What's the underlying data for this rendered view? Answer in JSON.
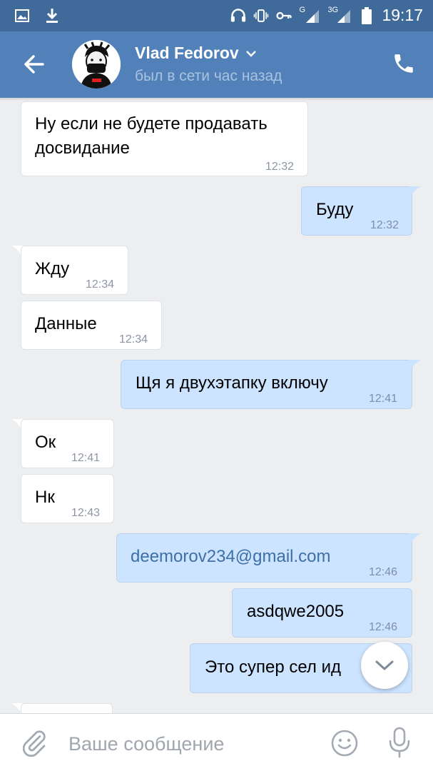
{
  "status_bar": {
    "network_label": "G",
    "network2_label": "3G",
    "time": "19:17"
  },
  "header": {
    "contact_name": "Vlad Fedorov",
    "contact_status": "был в сети час назад",
    "icons": [
      "back-arrow-icon",
      "chevron-down-icon",
      "phone-icon"
    ]
  },
  "messages": [
    {
      "direction": "in",
      "text": "Ну если не будете продавать\nдосвидание",
      "time": "12:32"
    },
    {
      "direction": "out",
      "text": "Буду",
      "time": "12:32"
    },
    {
      "direction": "in",
      "text": "Жду",
      "time": "12:34"
    },
    {
      "direction": "in",
      "text": "Данные",
      "time": "12:34"
    },
    {
      "direction": "out",
      "text": "Щя я двухэтапку включу",
      "time": "12:41"
    },
    {
      "direction": "in",
      "text": "Ок",
      "time": "12:41"
    },
    {
      "direction": "in",
      "text": "Нк",
      "time": "12:43"
    },
    {
      "direction": "out",
      "text": "deemorov234@gmail.com",
      "time": "12:46",
      "is_link": true
    },
    {
      "direction": "out",
      "text": "asdqwe2005",
      "time": "12:46"
    },
    {
      "direction": "out",
      "text": "Это супер сел ид",
      "time": ""
    }
  ],
  "composer": {
    "placeholder": "Ваше сообщение",
    "value": ""
  },
  "colors": {
    "header": "#5181b8",
    "status_bar": "#3f6a99",
    "background": "#edeef0",
    "bubble_in": "#ffffff",
    "bubble_out": "#cce4ff",
    "link": "#3e6fa6"
  }
}
